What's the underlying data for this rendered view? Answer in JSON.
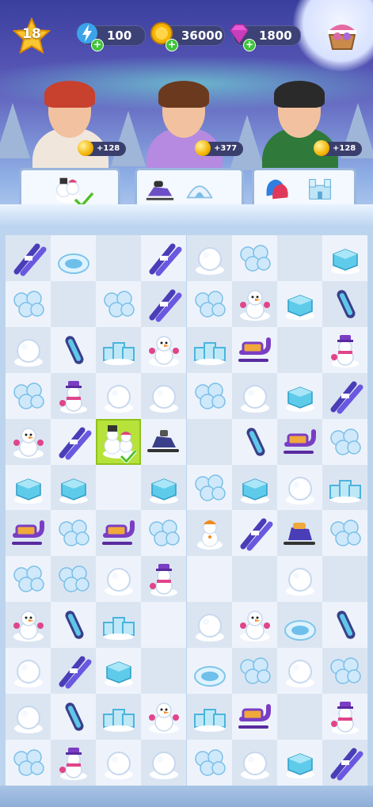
{
  "topbar": {
    "level": "18",
    "energy": "100",
    "coins": "36000",
    "gems": "1800",
    "icons": {
      "energy": "lightning-icon",
      "coins": "coin-icon",
      "gems": "gem-icon",
      "shop": "shop-basket-icon"
    }
  },
  "characters": [
    {
      "name": "red-hair-girl",
      "reward": "+128",
      "hair": "#c8402e",
      "coat": "#f0e6dc"
    },
    {
      "name": "purple-parka-girl",
      "reward": "+377",
      "hair": "#6b3a1e",
      "coat": "#b58ae0"
    },
    {
      "name": "green-jacket-man",
      "reward": "+128",
      "hair": "#2a2a2a",
      "coat": "#2f7a3a"
    }
  ],
  "orders": [
    {
      "items": [
        "snowman-kid"
      ],
      "done": true
    },
    {
      "items": [
        "snowmobile",
        "igloo"
      ],
      "done": false
    },
    {
      "items": [
        "mittens",
        "ice-castle"
      ],
      "done": false
    }
  ],
  "board": {
    "cols": 8,
    "rows": 12,
    "selected": {
      "row": 4,
      "col": 2
    },
    "grid": [
      [
        "skis",
        "igloo",
        "",
        "skis",
        "snowball",
        "snowflake",
        "",
        "ice-block"
      ],
      [
        "snowflake",
        "",
        "snowflake",
        "skis",
        "snowflake",
        "snowman",
        "ice-block",
        "snowboard"
      ],
      [
        "snowball",
        "snowboard",
        "ice-wall",
        "snowman",
        "ice-wall",
        "sled",
        "",
        "snowman-hat"
      ],
      [
        "snowflake",
        "snowman-hat",
        "snowball",
        "snowball",
        "snowflake",
        "snowball",
        "ice-block",
        "skis"
      ],
      [
        "snowman",
        "skis",
        "snowman-kid",
        "snowmobile",
        "",
        "snowboard",
        "sled",
        "snowflake"
      ],
      [
        "ice-block",
        "ice-block",
        "",
        "ice-block",
        "snowflake",
        "ice-block",
        "snowball",
        "ice-wall"
      ],
      [
        "sled",
        "snowflake",
        "sled",
        "snowflake",
        "snowman-small",
        "skis",
        "snowmobile-sled",
        "snowflake"
      ],
      [
        "snowflake",
        "snowflake",
        "snowball",
        "snowman-hat",
        "",
        "",
        "snowball",
        ""
      ],
      [
        "snowman",
        "snowboard",
        "ice-wall",
        "",
        "snowball",
        "snowman",
        "igloo",
        "snowboard"
      ],
      [
        "snowball",
        "skis",
        "ice-block",
        "",
        "igloo",
        "snowflake",
        "snowball",
        "snowflake"
      ],
      [
        "snowball",
        "snowboard",
        "ice-wall",
        "snowman",
        "ice-wall",
        "sled",
        "",
        "snowman-hat"
      ],
      [
        "snowflake",
        "snowman-hat",
        "snowball",
        "snowball",
        "snowflake",
        "snowball",
        "ice-block",
        "skis"
      ]
    ]
  },
  "colors": {
    "accent": "#9b59d6",
    "ice": "#5fc7e8",
    "select": "#b6e23a"
  }
}
